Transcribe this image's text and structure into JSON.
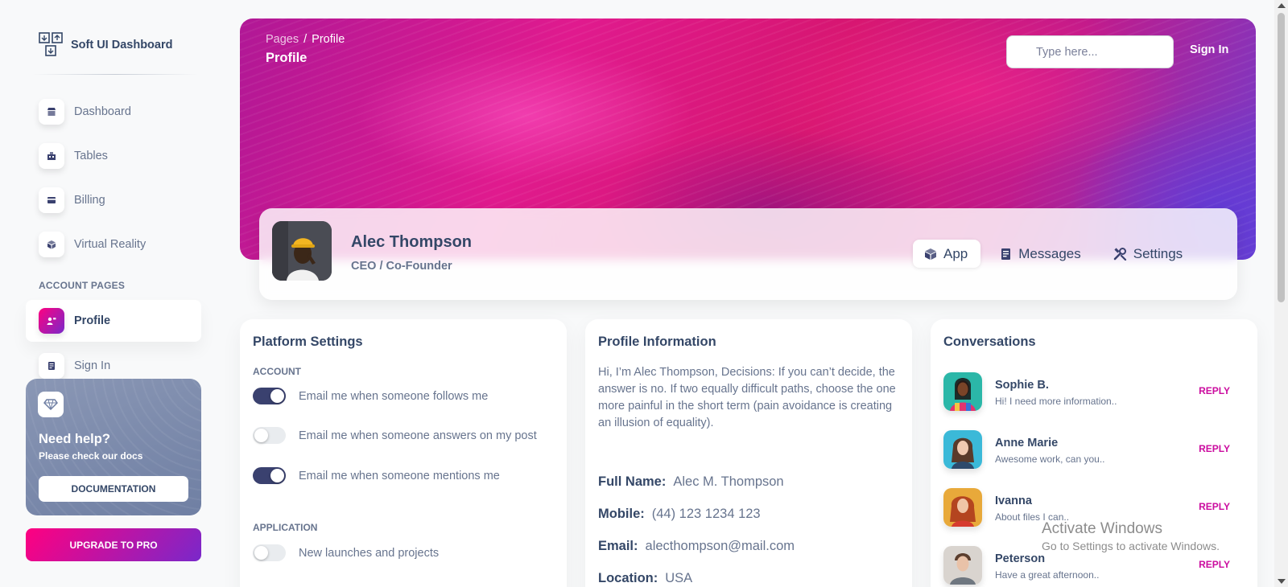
{
  "brand": {
    "name": "Soft UI Dashboard"
  },
  "sidebar": {
    "items": [
      {
        "label": "Dashboard",
        "icon": "shop-icon"
      },
      {
        "label": "Tables",
        "icon": "office-icon"
      },
      {
        "label": "Billing",
        "icon": "credit-card-icon"
      },
      {
        "label": "Virtual Reality",
        "icon": "box-3d-icon"
      }
    ],
    "section_label": "ACCOUNT PAGES",
    "account_items": [
      {
        "label": "Profile",
        "icon": "customer-support-icon",
        "active": true
      },
      {
        "label": "Sign In",
        "icon": "document-icon"
      }
    ],
    "help": {
      "title": "Need help?",
      "subtitle": "Please check our docs",
      "button": "DOCUMENTATION"
    },
    "upgrade_button": "UPGRADE TO PRO"
  },
  "header": {
    "breadcrumb_root": "Pages",
    "breadcrumb_sep": "/",
    "breadcrumb_current": "Profile",
    "title": "Profile",
    "search_placeholder": "Type here...",
    "sign_in": "Sign In"
  },
  "profile": {
    "name": "Alec Thompson",
    "role": "CEO / Co-Founder",
    "tabs": [
      {
        "label": "App",
        "icon": "cube-icon",
        "active": true
      },
      {
        "label": "Messages",
        "icon": "document-icon"
      },
      {
        "label": "Settings",
        "icon": "settings-icon"
      }
    ]
  },
  "platform_settings": {
    "title": "Platform Settings",
    "account_heading": "ACCOUNT",
    "account_switches": [
      {
        "label": "Email me when someone follows me",
        "on": true
      },
      {
        "label": "Email me when someone answers on my post",
        "on": false
      },
      {
        "label": "Email me when someone mentions me",
        "on": true
      }
    ],
    "application_heading": "APPLICATION",
    "application_switches": [
      {
        "label": "New launches and projects",
        "on": false
      }
    ]
  },
  "profile_info": {
    "title": "Profile Information",
    "about": "Hi, I’m Alec Thompson, Decisions: If you can’t decide, the answer is no. If two equally difficult paths, choose the one more painful in the short term (pain avoidance is creating an illusion of equality).",
    "fields": [
      {
        "key": "Full Name:",
        "value": "Alec M. Thompson"
      },
      {
        "key": "Mobile:",
        "value": "(44) 123 1234 123"
      },
      {
        "key": "Email:",
        "value": "alecthompson@mail.com"
      },
      {
        "key": "Location:",
        "value": "USA"
      }
    ]
  },
  "conversations": {
    "title": "Conversations",
    "reply_label": "REPLY",
    "items": [
      {
        "name": "Sophie B.",
        "message": "Hi! I need more information.."
      },
      {
        "name": "Anne Marie",
        "message": "Awesome work, can you.."
      },
      {
        "name": "Ivanna",
        "message": "About files I can.."
      },
      {
        "name": "Peterson",
        "message": "Have a great afternoon.."
      }
    ]
  },
  "watermark": {
    "line1": "Activate Windows",
    "line2": "Go to Settings to activate Windows."
  },
  "colors": {
    "primary_gradient_start": "#7928ca",
    "primary_gradient_end": "#ff0080",
    "reply_color": "#cb0c9f",
    "switch_on": "#3a416f",
    "text_dark": "#344767",
    "text_muted": "#67748e"
  }
}
